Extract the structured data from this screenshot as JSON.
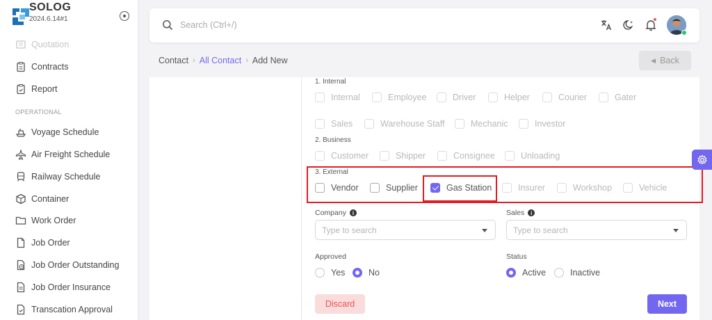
{
  "brand": {
    "name": "SOLOG",
    "version": "2024.6.14#1"
  },
  "sidebar": {
    "section_label": "OPERATIONAL",
    "items": [
      {
        "label": "Quotation",
        "icon": "document-icon"
      },
      {
        "label": "Contracts",
        "icon": "clipboard-icon"
      },
      {
        "label": "Report",
        "icon": "clipboard-check-icon"
      },
      {
        "label": "Voyage Schedule",
        "icon": "ship-icon"
      },
      {
        "label": "Air Freight Schedule",
        "icon": "plane-icon"
      },
      {
        "label": "Railway Schedule",
        "icon": "train-icon"
      },
      {
        "label": "Container",
        "icon": "box-icon"
      },
      {
        "label": "Work Order",
        "icon": "folder-icon"
      },
      {
        "label": "Job Order",
        "icon": "file-icon"
      },
      {
        "label": "Job Order Outstanding",
        "icon": "file-clock-icon"
      },
      {
        "label": "Job Order Insurance",
        "icon": "file-text-icon"
      },
      {
        "label": "Transcation Approval",
        "icon": "file-check-icon"
      }
    ]
  },
  "search": {
    "placeholder": "Search (Ctrl+/)"
  },
  "breadcrumb": {
    "root": "Contact",
    "middle": "All Contact",
    "current": "Add New"
  },
  "back_label": "Back",
  "groups": {
    "internal": {
      "title": "1. Internal",
      "options": [
        "Internal",
        "Employee",
        "Driver",
        "Helper",
        "Courier",
        "Gater",
        "Sales",
        "Warehouse Staff",
        "Mechanic",
        "Investor"
      ]
    },
    "business": {
      "title": "2. Business",
      "options": [
        "Customer",
        "Shipper",
        "Consignee",
        "Unloading"
      ]
    },
    "external": {
      "title": "3. External",
      "options": [
        "Vendor",
        "Supplier",
        "Gas Station",
        "Insurer",
        "Workshop",
        "Vehicle"
      ],
      "checked": "Gas Station"
    }
  },
  "company": {
    "label": "Company",
    "placeholder": "Type to search"
  },
  "sales": {
    "label": "Sales",
    "placeholder": "Type to search"
  },
  "approved": {
    "label": "Approved",
    "options": [
      "Yes",
      "No"
    ],
    "selected": "No"
  },
  "status": {
    "label": "Status",
    "options": [
      "Active",
      "Inactive"
    ],
    "selected": "Active"
  },
  "buttons": {
    "discard": "Discard",
    "next": "Next"
  },
  "colors": {
    "primary": "#7367f0",
    "danger": "#ea5455",
    "highlight": "#e31b23",
    "online": "#28c76f"
  }
}
